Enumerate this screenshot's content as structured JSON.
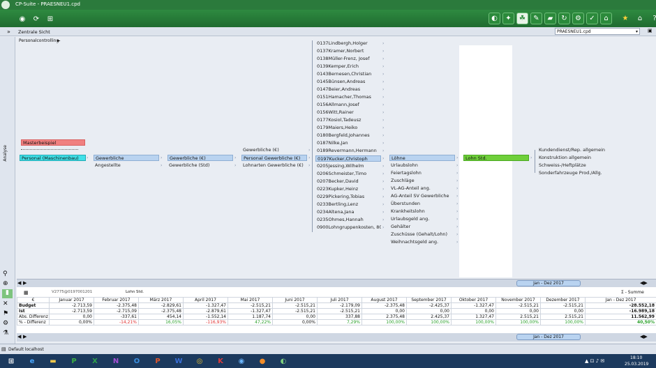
{
  "window": {
    "title": "CP-Suite - PRAESNEU1.cpd"
  },
  "nav": {
    "expand_glyph": "»",
    "section": "Zentrale Sicht",
    "file_select": "PRAESNEU1.cpd"
  },
  "canvas": {
    "breadcrumb": "Personalcontrolling",
    "level1": {
      "masterbeispiel": "Masterbeispiel",
      "selected": "Personal (Maschinenbau)"
    },
    "level2": {
      "selected": "Gewerbliche",
      "other": "Angestellte"
    },
    "level3": {
      "selected": "Gewerbliche (€)",
      "other": "Gewerbliche (Std)"
    },
    "level4": {
      "top": "Gewerbliche (€)",
      "selected": "Personal Gewerbliche (€)",
      "bottom": "Lohnarten Gewerbliche (€)"
    },
    "employees": [
      "0137Lindbergh,Holger",
      "0137Kramer,Norbert",
      "0138Müller-Frenz, Josef",
      "0139Kemper,Erich",
      "0143Bernesen,Christian",
      "0145Bünsen,Andreas",
      "0147Beier,Andreas",
      "0151Hamacher,Thomas",
      "0156Allmann,Josef",
      "0156Witt,Rainer",
      "0177Kosiol,Tadeusz",
      "0179Maiers,Heiko",
      "0180Bergfeld,Johannes",
      "0187Nilke,Jan",
      "0189Revermann,Hermann"
    ],
    "employee_selected": "0197Kucker,Christoph",
    "employees_after": [
      "0205Jessing,Wilhelm",
      "0206Schmeister,Timo",
      "0207Becker,David",
      "0223Kupker,Heinz",
      "0229Pickering,Tobias",
      "0233Bertling,Lenz",
      "0234Altena,Jana",
      "0235Ohmes,Hannah",
      "0900Lohngruppenkosten, 80 %"
    ],
    "lohne": {
      "selected": "Löhne",
      "items": [
        "Urlaubslohn",
        "Feiertagslohn",
        "Zuschläge",
        "VL-AG-Anteil ang.",
        "AG-Anteil SV Gewerbliche",
        "Überstunden",
        "Krankheitslohn",
        "Urlaubsgeld ang.",
        "Gehälter",
        "Zuschüsse (Gehalt/Lohn)",
        "Weihnachtsgeld ang."
      ]
    },
    "lohn_std": "Lohn Std.",
    "targets": [
      "Kundendienst/Rep. allgemein",
      "Konstruktion allgemein",
      "Schweiss-/Heftplätze",
      "Sonderfahrzeuge Prod./Allg."
    ]
  },
  "left_strip": {
    "label": "Analyse"
  },
  "range_pill": "Jan - Dez 2017",
  "range_pill2": "Jan - Dez 2017",
  "sum_label": "Σ - Summe",
  "table_meta": {
    "path": "V2775@0197001201",
    "measure": "Lohn Std."
  },
  "table": {
    "headers": [
      "€",
      "Januar 2017",
      "Februar 2017",
      "März 2017",
      "April 2017",
      "Mai 2017",
      "Juni 2017",
      "Juli 2017",
      "August 2017",
      "September 2017",
      "Oktober 2017",
      "November 2017",
      "Dezember 2017",
      "Jan - Dez 2017"
    ],
    "rows": [
      {
        "label": "Budget",
        "values": [
          "-2.713,59",
          "-2.375,48",
          "-2.829,61",
          "-1.327,47",
          "-2.515,21",
          "-2.515,21",
          "-2.179,09",
          "-2.375,48",
          "-2.425,37",
          "-1.327,47",
          "-2.515,21",
          "-2.515,21",
          "-28.552,18"
        ]
      },
      {
        "label": "Ist",
        "values": [
          "-2.713,59",
          "-2.715,09",
          "-2.375,48",
          "-2.879,61",
          "-1.327,47",
          "-2.515,21",
          "-2.515,21",
          "0,00",
          "0,00",
          "0,00",
          "0,00",
          "0,00",
          "-16.989,18"
        ]
      },
      {
        "label": "Abs. Differenz",
        "values": [
          "0,00",
          "-337,61",
          "454,14",
          "-1.552,14",
          "1.187,74",
          "0,00",
          "337,88",
          "2.375,48",
          "2.425,37",
          "1.327,47",
          "2.515,21",
          "2.515,21",
          "11.562,99"
        ]
      },
      {
        "label": "% - Differenz",
        "values": [
          "0,00%",
          "-14,21%",
          "16,05%",
          "-116,93%",
          "47,22%",
          "0,00%",
          "7,29%",
          "100,00%",
          "100,00%",
          "100,00%",
          "100,00%",
          "100,00%",
          "40,50%"
        ]
      }
    ]
  },
  "status": {
    "text": "Default localhost"
  },
  "taskbar": {
    "time": "18:10",
    "date": "25.03.2019"
  },
  "colors": {
    "green": "#2b8a3b",
    "selected_blue": "#b9d3f0",
    "cyan": "#40e0e8",
    "red": "#f08080",
    "lime": "#6fcf3a",
    "neg": "#e03030",
    "pos": "#2aa02a"
  }
}
